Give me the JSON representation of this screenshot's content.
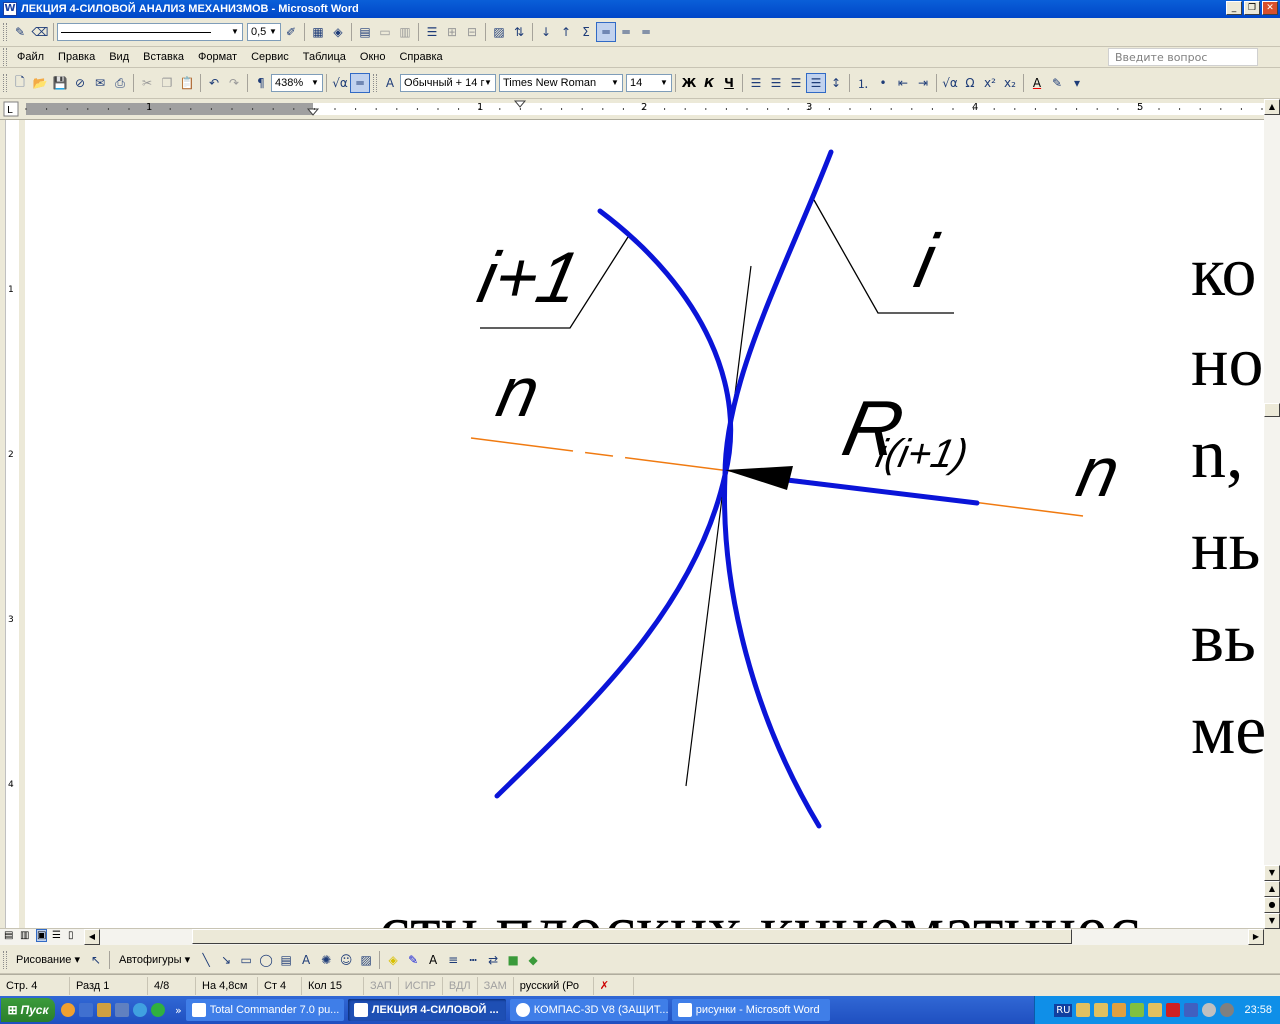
{
  "window": {
    "title": "ЛЕКЦИЯ 4-СИЛОВОЙ АНАЛИЗ МЕХАНИЗМОВ - Microsoft Word",
    "app_icon": "W"
  },
  "top_toolbar": {
    "line_weight": "0,5"
  },
  "menu": {
    "items": [
      "Файл",
      "Правка",
      "Вид",
      "Вставка",
      "Формат",
      "Сервис",
      "Таблица",
      "Окно",
      "Справка"
    ],
    "ask_placeholder": "Введите вопрос"
  },
  "format_toolbar": {
    "zoom": "438%",
    "style": "Обычный + 14 г",
    "font": "Times New Roman",
    "size": "14",
    "bold": "Ж",
    "italic": "К",
    "underline": "Ч"
  },
  "ruler": {
    "h_numbers": [
      "1",
      "1",
      "2",
      "3",
      "4",
      "5"
    ],
    "v_numbers": [
      "1",
      "2",
      "3",
      "4"
    ]
  },
  "drawing": {
    "label_i1": "i+1",
    "label_i": "i",
    "label_n_left": "n",
    "label_n_right": "n",
    "label_r_main": "R",
    "label_r_sub": "i(i+1)"
  },
  "document_text": {
    "lines": [
      "ко",
      "но",
      "n,",
      "нь",
      "вь",
      "ме"
    ],
    "bottom": "сти плоских кинематичес"
  },
  "draw_toolbar": {
    "draw": "Рисование ▾",
    "autoshapes": "Автофигуры ▾"
  },
  "status": {
    "page": "Стр. 4",
    "section": "Разд 1",
    "pages": "4/8",
    "at": "На 4,8см",
    "line": "Ст 4",
    "col": "Кол 15",
    "rec": "ЗАП",
    "trk": "ИСПР",
    "ext": "ВДЛ",
    "ovr": "ЗАМ",
    "lang": "русский (Ро"
  },
  "taskbar": {
    "start": "Пуск",
    "tasks": [
      "Total Commander 7.0 pu...",
      "ЛЕКЦИЯ 4-СИЛОВОЙ ...",
      "КОМПАС-3D V8 (ЗАЩИТ...",
      "рисунки - Microsoft Word"
    ],
    "lang": "RU",
    "clock": "23:58"
  },
  "colors": {
    "curve": "#0a14d8",
    "normal_line": "#f07a10",
    "title_bar": "#0a5fd8",
    "taskbar": "#2a5ed0"
  }
}
